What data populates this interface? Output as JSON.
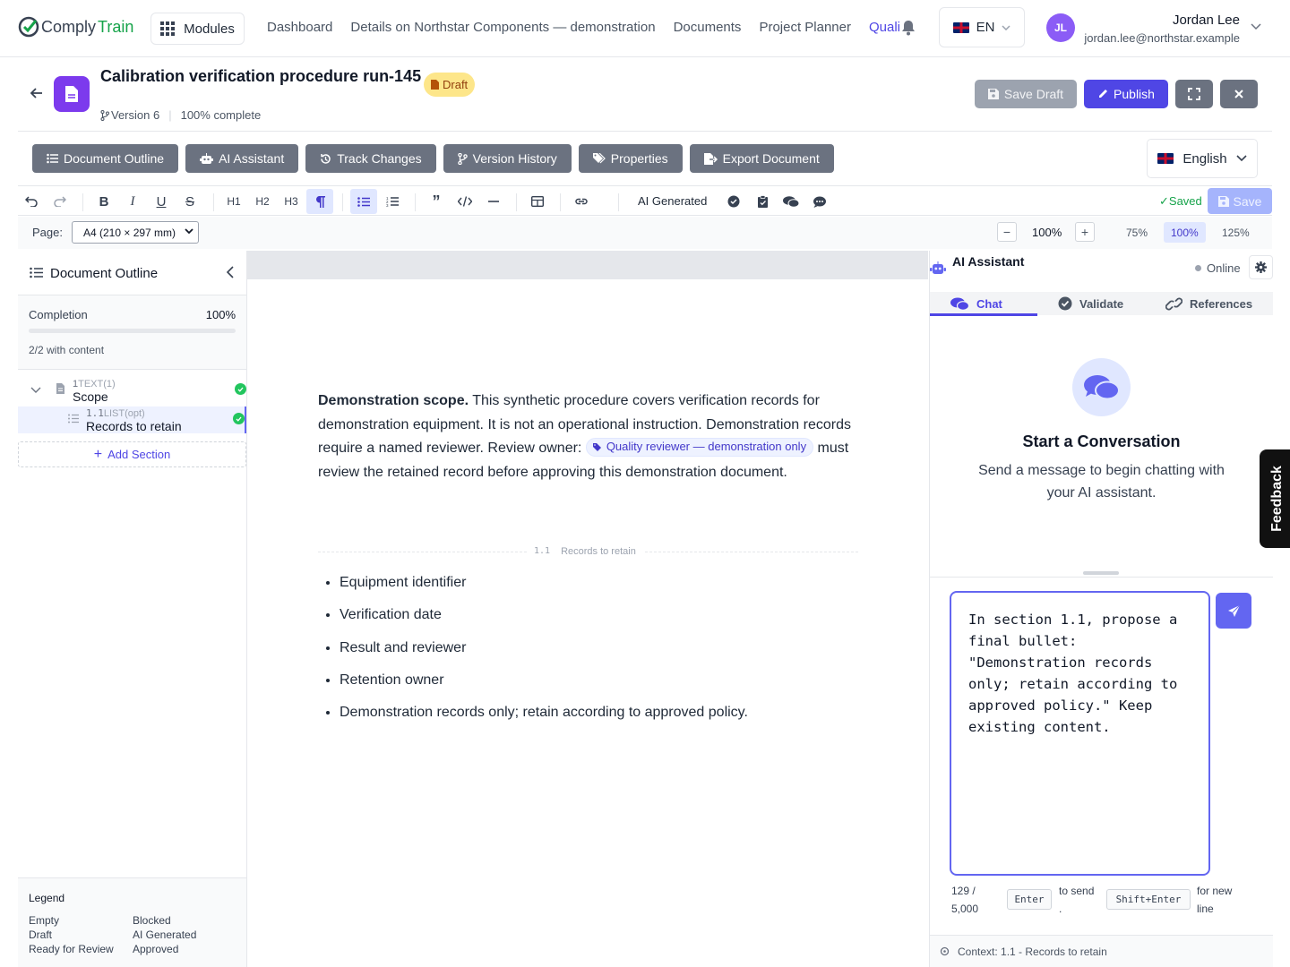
{
  "brand": {
    "part1": "Comply",
    "part2": "Train"
  },
  "nav": {
    "modules_label": "Modules",
    "links": [
      "Dashboard",
      "Details on Northstar Components — demonstration",
      "Documents",
      "Project Planner",
      "Quali"
    ],
    "language": "EN"
  },
  "user": {
    "initials": "JL",
    "name": "Jordan Lee",
    "email": "jordan.lee@northstar.example"
  },
  "document": {
    "title": "Calibration verification procedure run-145",
    "status": "Draft",
    "version": "Version 6",
    "completion": "100% complete"
  },
  "actions": {
    "save_draft": "Save Draft",
    "publish": "Publish"
  },
  "tabs": [
    "Document Outline",
    "AI Assistant",
    "Track Changes",
    "Version History",
    "Properties",
    "Export Document"
  ],
  "doc_language": "English",
  "toolbar": {
    "h1": "H1",
    "h2": "H2",
    "h3": "H3",
    "ai_generated": "AI Generated",
    "saved": "✓Saved",
    "save": "Save"
  },
  "page": {
    "label": "Page:",
    "size": "A4 (210 × 297 mm)",
    "zoom": "100%",
    "zoom_options": [
      "75%",
      "100%",
      "125%"
    ]
  },
  "outline": {
    "title": "Document Outline",
    "completion_label": "Completion",
    "completion_value": "100%",
    "completion_fraction": 1.0,
    "with_content": "2/2 with content",
    "items": [
      {
        "num": "1",
        "type": "TEXT(1)",
        "name": "Scope"
      },
      {
        "num": "1.1",
        "type": "LIST(opt)",
        "name": "Records to retain"
      }
    ],
    "add_section": "Add Section",
    "legend_title": "Legend",
    "legend": [
      "Empty",
      "Blocked",
      "Draft",
      "AI Generated",
      "Ready for Review",
      "Approved"
    ]
  },
  "content": {
    "lead_bold": "Demonstration scope.",
    "lead_text": " This synthetic procedure covers verification records for demonstration equipment. It is not an operational instruction. Demonstration records require a named reviewer. Review owner: ",
    "chip": "Quality reviewer — demonstration only",
    "tail_text": " must review the retained record before approving this demonstration document.",
    "section_num": "1.1",
    "section_title": "Records to retain",
    "bullets": [
      "Equipment identifier",
      "Verification date",
      "Result and reviewer",
      "Retention owner",
      "Demonstration records only; retain according to approved policy."
    ]
  },
  "assistant": {
    "title": "AI Assistant",
    "status": "Online",
    "tabs": [
      "Chat",
      "Validate",
      "References"
    ],
    "heading": "Start a Conversation",
    "subtext": "Send a message to begin chatting with your AI assistant.",
    "input": "In section 1.1, propose a final bullet: \"Demonstration records only; retain according to approved policy.\" Keep existing content.",
    "char_count": "129 / 5,000",
    "key_send": "Enter",
    "send_note": "to send .",
    "key_newline": "Shift+Enter",
    "newline_note": "for new line",
    "context": "Context: 1.1 - Records to retain"
  },
  "feedback": "Feedback",
  "colors": {
    "accent": "#4f46e5",
    "success": "#22c55e",
    "draft_badge": "#fde68a",
    "tab_button": "#6b7280"
  }
}
